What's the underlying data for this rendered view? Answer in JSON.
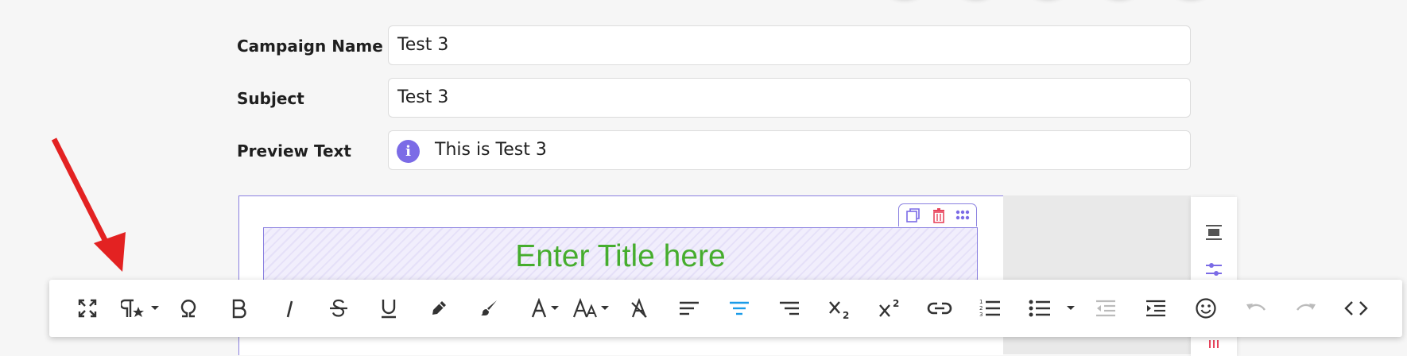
{
  "form": {
    "campaign_name": {
      "label": "Campaign Name",
      "value": "Test 3"
    },
    "subject": {
      "label": "Subject",
      "value": "Test 3"
    },
    "preview_text": {
      "label": "Preview Text",
      "value": "This is Test 3"
    }
  },
  "editor": {
    "title_placeholder": "Enter Title here",
    "block_tools": [
      "duplicate-icon",
      "trash-icon",
      "drag-handle-icon"
    ],
    "side_tools": [
      "align-block-icon",
      "settings-sliders-icon"
    ]
  },
  "toolbar": {
    "buttons": [
      "fullscreen-icon",
      "paragraph-style-icon",
      "special-character-icon",
      "bold-icon",
      "italic-icon",
      "strikethrough-icon",
      "underline-icon",
      "highlight-icon",
      "paint-brush-icon",
      "font-color-icon",
      "font-size-icon",
      "clear-format-icon",
      "align-left-icon",
      "align-center-icon",
      "align-right-icon",
      "subscript-icon",
      "superscript-icon",
      "link-icon",
      "ordered-list-icon",
      "unordered-list-icon",
      "outdent-icon",
      "indent-icon",
      "emoji-icon",
      "undo-icon",
      "redo-icon",
      "code-view-icon"
    ],
    "active_button": "align-center-icon"
  },
  "colors": {
    "accent": "#7b6be6",
    "title_green": "#46ad2e",
    "active_blue": "#1a9be8",
    "annotation_arrow": "#e32222",
    "delete_red": "#e8455d"
  }
}
